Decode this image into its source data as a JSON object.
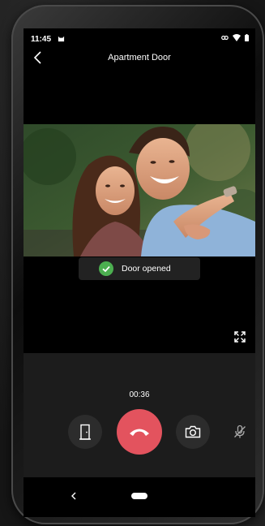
{
  "status_bar": {
    "time": "11:45",
    "left_icon": "cat-icon",
    "right_icons": [
      "link-icon",
      "wifi-icon",
      "battery-icon"
    ]
  },
  "header": {
    "back_icon": "chevron-left-icon",
    "title": "Apartment Door"
  },
  "video": {
    "description_icon": "live-video-feed"
  },
  "toast": {
    "icon": "check-circle-icon",
    "text": "Door opened",
    "color": "#4caf50"
  },
  "call": {
    "duration": "00:36",
    "buttons": [
      {
        "name": "door-button",
        "icon": "door-icon"
      },
      {
        "name": "hangup-button",
        "icon": "phone-hangup-icon"
      },
      {
        "name": "camera-button",
        "icon": "camera-icon"
      },
      {
        "name": "mic-button",
        "icon": "mic-muted-icon"
      }
    ]
  },
  "colors": {
    "hangup": "#e3535e",
    "panel": "#1c1c1c",
    "button": "#2c2c2c",
    "background": "#000000"
  }
}
